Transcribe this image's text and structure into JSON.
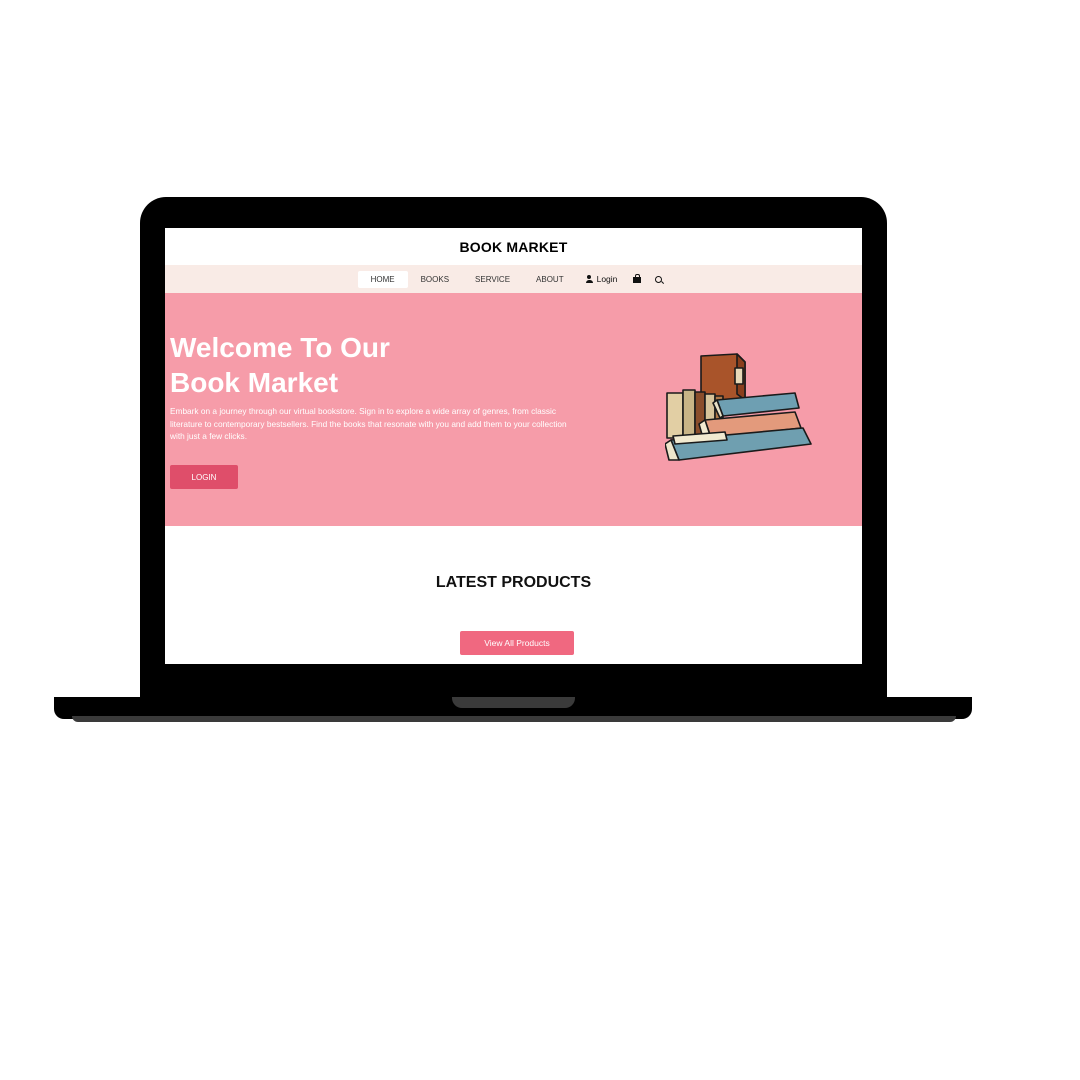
{
  "header": {
    "title": "BOOK MARKET"
  },
  "nav": {
    "items": [
      {
        "label": "HOME",
        "active": true
      },
      {
        "label": "BOOKS",
        "active": false
      },
      {
        "label": "SERVICE",
        "active": false
      },
      {
        "label": "ABOUT",
        "active": false
      }
    ],
    "login_label": "Login",
    "icons": [
      "user-icon",
      "bag-icon",
      "search-icon"
    ]
  },
  "hero": {
    "title_line1": "Welcome To Our",
    "title_line2": "Book Market",
    "description": "Embark on a journey through our virtual bookstore. Sign in to explore a wide array of genres, from classic literature to contemporary bestsellers. Find the books that resonate with you and add them to your collection with just a few clicks.",
    "button_label": "LOGIN"
  },
  "latest": {
    "title": "LATEST PRODUCTS",
    "button_label": "View All Products"
  },
  "colors": {
    "hero_bg": "#f69ca9",
    "nav_bg": "#f9ebe6",
    "login_button": "#df4e6a",
    "view_button": "#f06880"
  }
}
